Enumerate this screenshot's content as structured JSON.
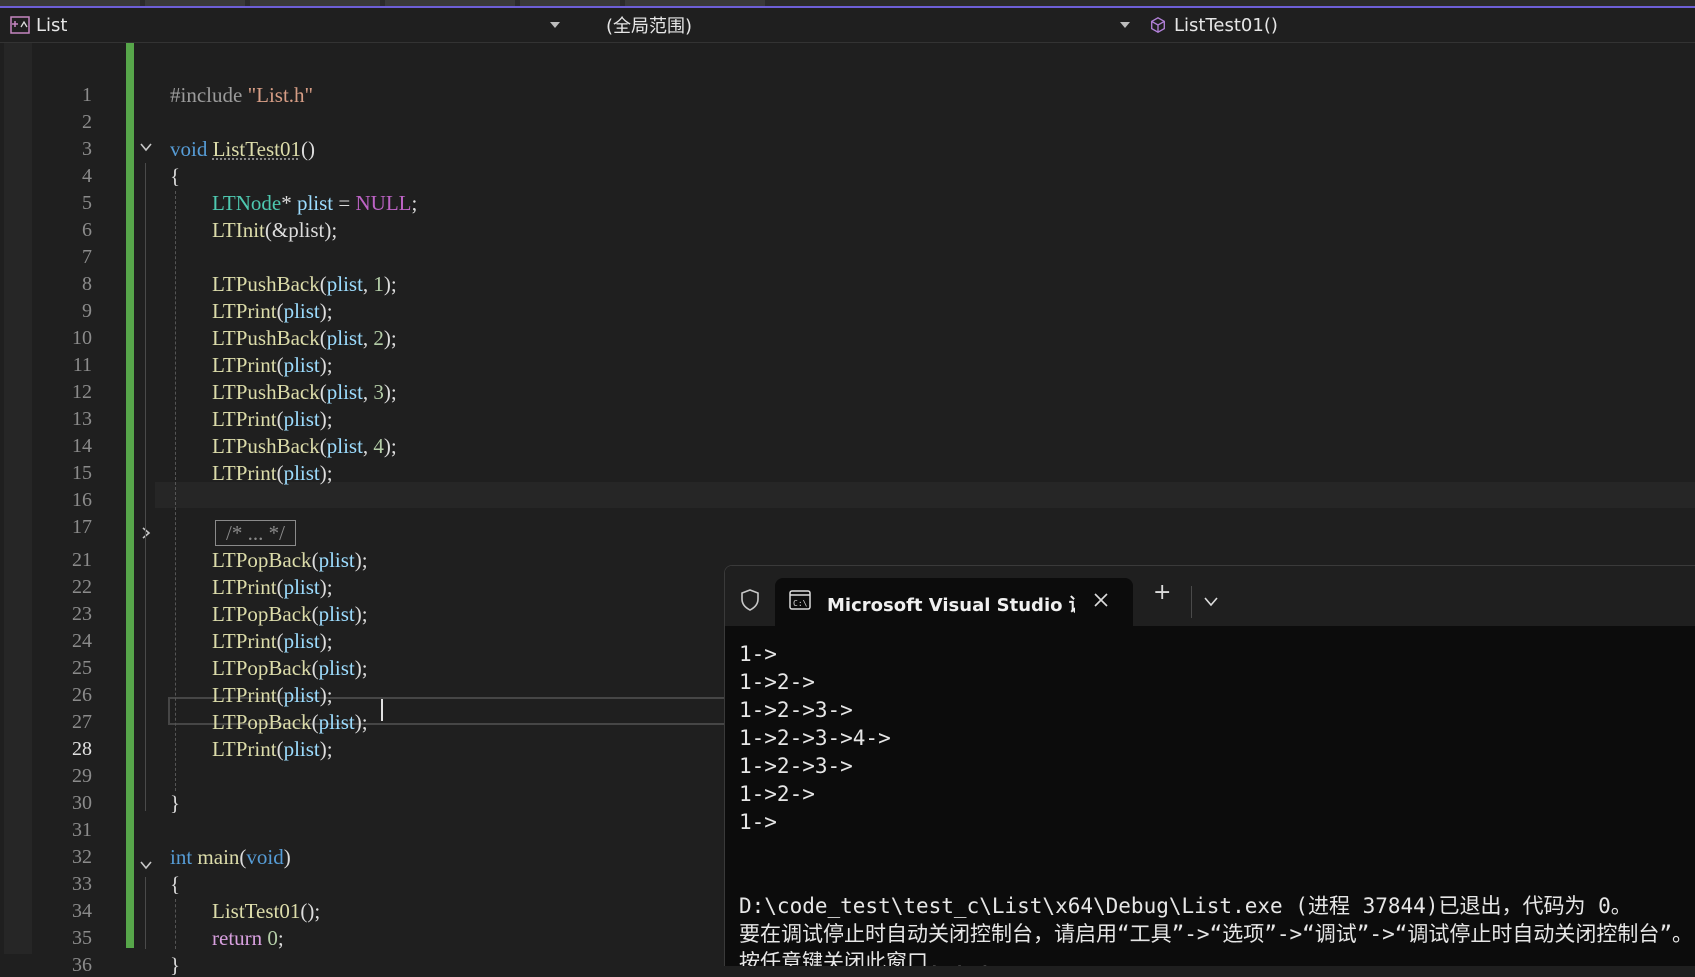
{
  "navbar": {
    "project": "List",
    "scope": "(全局范围)",
    "member": "ListTest01()"
  },
  "editor": {
    "active_line": "28",
    "lines": [
      {
        "n": "1"
      },
      {
        "n": "2"
      },
      {
        "n": "3"
      },
      {
        "n": "4"
      },
      {
        "n": "5"
      },
      {
        "n": "6"
      },
      {
        "n": "7"
      },
      {
        "n": "8"
      },
      {
        "n": "9"
      },
      {
        "n": "10"
      },
      {
        "n": "11"
      },
      {
        "n": "12"
      },
      {
        "n": "13"
      },
      {
        "n": "14"
      },
      {
        "n": "15"
      },
      {
        "n": "16"
      },
      {
        "n": "17"
      },
      {
        "n": "21"
      },
      {
        "n": "22"
      },
      {
        "n": "23"
      },
      {
        "n": "24"
      },
      {
        "n": "25"
      },
      {
        "n": "26"
      },
      {
        "n": "27"
      },
      {
        "n": "28"
      },
      {
        "n": "29"
      },
      {
        "n": "30"
      },
      {
        "n": "31"
      },
      {
        "n": "32"
      },
      {
        "n": "33"
      },
      {
        "n": "34"
      },
      {
        "n": "35"
      },
      {
        "n": "36"
      }
    ],
    "code": {
      "l1_pre": "#include ",
      "l1_str": "\"List.h\"",
      "l3_kw": "void",
      "l3_fn": "ListTest01",
      "l3_rest": "()",
      "brace_open": "{",
      "brace_close": "}",
      "l5_ty": "LTNode",
      "l5_star": "* ",
      "l5_var": "plist",
      "l5_eq": " = ",
      "l5_mac": "NULL",
      "semi": ";",
      "l6_fn": "LTInit",
      "l6_arg": "(&plist);",
      "push": "LTPushBack",
      "print": "LTPrint",
      "pop": "LTPopBack",
      "plist": "plist",
      "open_paren": "(",
      "close_semi": ");",
      "comma": ", ",
      "n1": "1",
      "n2": "2",
      "n3": "3",
      "n4": "4",
      "collapsed": "/* ... */",
      "l32_kw": "int",
      "l32_fn": "main",
      "l32_void": "void",
      "l34_fn": "ListTest01",
      "l34_rest": "();",
      "l35_kw": "return",
      "l35_num": "0",
      "paren_open": "(",
      "paren_close": ")"
    }
  },
  "terminal": {
    "tab_title": "Microsoft Visual Studio 调试控制台",
    "add_label": "+",
    "output": [
      "1->",
      "1->2->",
      "1->2->3->",
      "1->2->3->4->",
      "1->2->3->",
      "1->2->",
      "1->",
      "",
      "",
      "D:\\code_test\\test_c\\List\\x64\\Debug\\List.exe (进程 37844)已退出，代码为 0。",
      "要在调试停止时自动关闭控制台，请启用“工具”->“选项”->“调试”->“调试停止时自动关闭控制台”。",
      "按任意键关闭此窗口. . ."
    ]
  },
  "colors": {
    "accent": "#6d5fd6",
    "change_bar": "#57a64a",
    "keyword": "#569cd6",
    "type": "#4ec9b0",
    "function": "#dcdcaa",
    "variable": "#9cdcfe",
    "number": "#b5cea8",
    "macro": "#bd63c5",
    "string": "#d69d85"
  }
}
